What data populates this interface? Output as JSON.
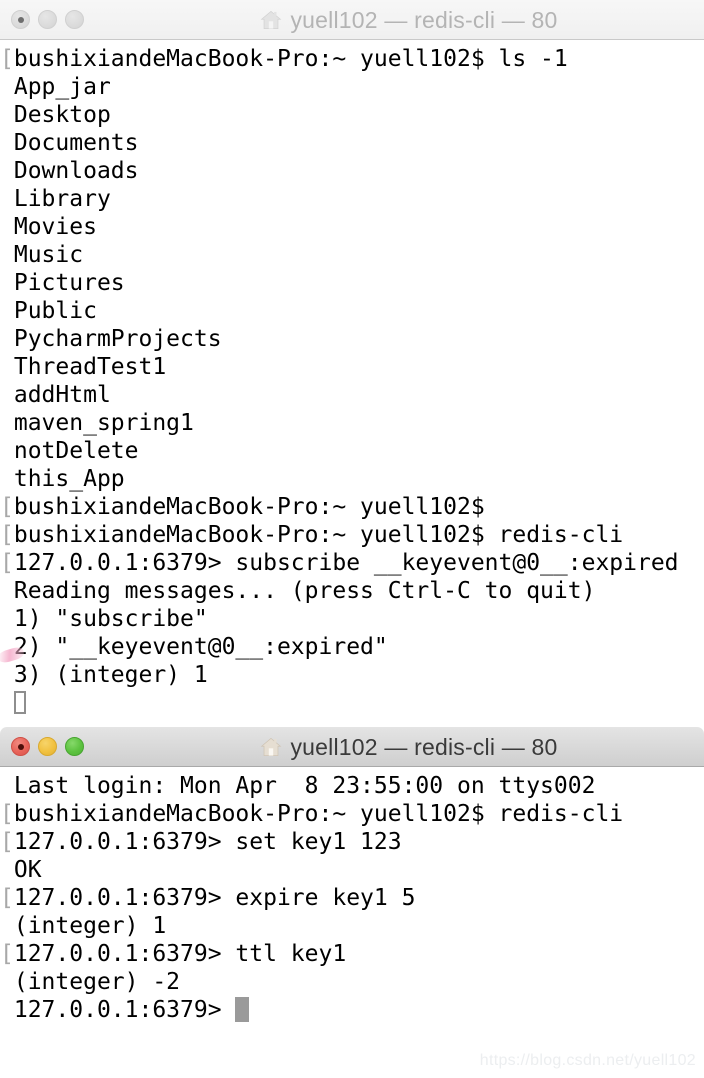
{
  "windows": [
    {
      "state": "inactive",
      "title": "yuell102 — redis-cli — 80",
      "icon": "home-icon",
      "buttons": {
        "close": "close-button",
        "minimize": "minimize-button",
        "zoom": "zoom-button"
      },
      "lines": [
        {
          "bracket": "[",
          "text": "bushixiandeMacBook-Pro:~ yuell102$ ls -1"
        },
        {
          "bracket": "",
          "text": "App_jar"
        },
        {
          "bracket": "",
          "text": "Desktop"
        },
        {
          "bracket": "",
          "text": "Documents"
        },
        {
          "bracket": "",
          "text": "Downloads"
        },
        {
          "bracket": "",
          "text": "Library"
        },
        {
          "bracket": "",
          "text": "Movies"
        },
        {
          "bracket": "",
          "text": "Music"
        },
        {
          "bracket": "",
          "text": "Pictures"
        },
        {
          "bracket": "",
          "text": "Public"
        },
        {
          "bracket": "",
          "text": "PycharmProjects"
        },
        {
          "bracket": "",
          "text": "ThreadTest1"
        },
        {
          "bracket": "",
          "text": "addHtml"
        },
        {
          "bracket": "",
          "text": "maven_spring1"
        },
        {
          "bracket": "",
          "text": "notDelete"
        },
        {
          "bracket": "",
          "text": "this_App"
        },
        {
          "bracket": "[",
          "text": "bushixiandeMacBook-Pro:~ yuell102$"
        },
        {
          "bracket": "[",
          "text": "bushixiandeMacBook-Pro:~ yuell102$ redis-cli"
        },
        {
          "bracket": "[",
          "text": "127.0.0.1:6379> subscribe __keyevent@0__:expired"
        },
        {
          "bracket": "",
          "text": "Reading messages... (press Ctrl-C to quit)"
        },
        {
          "bracket": "",
          "text": "1) \"subscribe\""
        },
        {
          "bracket": "",
          "text": "2) \"__keyevent@0__:expired\""
        },
        {
          "bracket": "",
          "text": "3) (integer) 1"
        }
      ],
      "cursor": "hollow"
    },
    {
      "state": "active",
      "title": "yuell102 — redis-cli — 80",
      "icon": "home-icon",
      "buttons": {
        "close": "close-button",
        "minimize": "minimize-button",
        "zoom": "zoom-button"
      },
      "lines": [
        {
          "bracket": "",
          "text": "Last login: Mon Apr  8 23:55:00 on ttys002"
        },
        {
          "bracket": "[",
          "text": "bushixiandeMacBook-Pro:~ yuell102$ redis-cli"
        },
        {
          "bracket": "[",
          "text": "127.0.0.1:6379> set key1 123"
        },
        {
          "bracket": "",
          "text": "OK"
        },
        {
          "bracket": "[",
          "text": "127.0.0.1:6379> expire key1 5"
        },
        {
          "bracket": "",
          "text": "(integer) 1"
        },
        {
          "bracket": "[",
          "text": "127.0.0.1:6379> ttl key1"
        },
        {
          "bracket": "",
          "text": "(integer) -2"
        }
      ],
      "prompt": "127.0.0.1:6379> ",
      "cursor": "block"
    }
  ],
  "watermark": "https://blog.csdn.net/yuell102",
  "colors": {
    "terminal_bg": "#ffffff",
    "terminal_fg": "#000000",
    "titlebar_inactive": "#f2f2f2",
    "titlebar_active": "#d8d8d8",
    "close_red": "#e8645a",
    "minimize_yellow": "#f1c140",
    "zoom_green": "#5cc23f",
    "cursor_gray": "#9a9a9a",
    "watermark": "#eceef0"
  }
}
